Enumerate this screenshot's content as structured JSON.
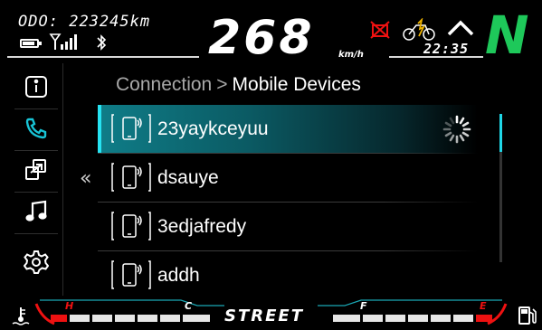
{
  "header": {
    "odometer_label": "ODO:",
    "odometer_value": "223245km",
    "speed_value": "268",
    "speed_unit": "km/h",
    "clock": "22:35",
    "gear": "N"
  },
  "sidebar": {
    "items": [
      {
        "name": "info",
        "icon": "info-icon",
        "active": false
      },
      {
        "name": "phone",
        "icon": "phone-icon",
        "active": true
      },
      {
        "name": "connectivity",
        "icon": "connect-icon",
        "active": false
      },
      {
        "name": "music",
        "icon": "music-icon",
        "active": false
      },
      {
        "name": "settings",
        "icon": "gear-icon",
        "active": false
      }
    ]
  },
  "breadcrumb": {
    "parent": "Connection",
    "separator": ">",
    "current": "Mobile Devices"
  },
  "back_chevron": "«",
  "devices": [
    {
      "name": "23yaykceyuu",
      "selected": true,
      "status": "connecting"
    },
    {
      "name": "dsauye",
      "selected": false
    },
    {
      "name": "3edjafredy",
      "selected": false
    },
    {
      "name": "addh",
      "selected": false
    }
  ],
  "footer": {
    "riding_mode": "STREET",
    "temp_high_label": "H",
    "temp_low_label": "C",
    "fuel_full_label": "F",
    "fuel_empty_label": "E"
  },
  "colors": {
    "accent": "#18c4d6",
    "gear": "#1ec85a",
    "warning": "#e11"
  }
}
